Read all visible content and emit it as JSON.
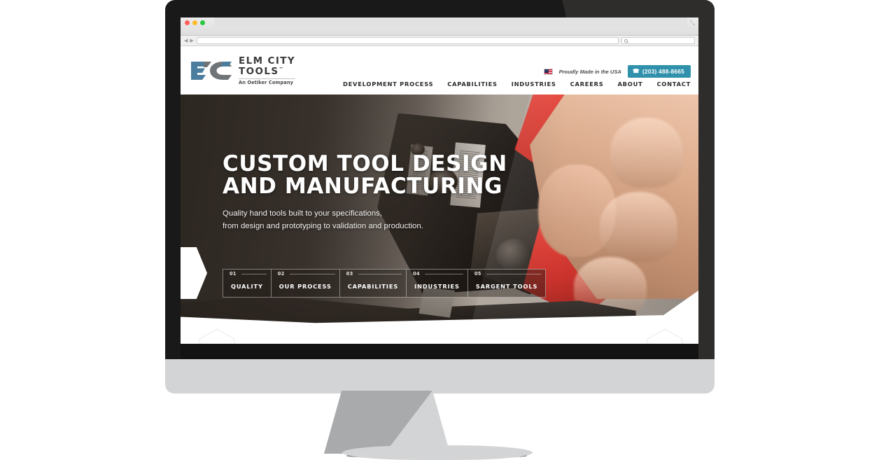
{
  "browser": {
    "traffic_lights": [
      "close",
      "minimize",
      "maximize"
    ],
    "url_value": "",
    "url_placeholder": "",
    "search_value": "",
    "search_placeholder": "",
    "back_glyph": "◀",
    "forward_glyph": "▶",
    "new_tab_glyph": "+",
    "resize_glyph": "⤡"
  },
  "site": {
    "logo": {
      "mark_alt": "EC monogram",
      "name_line1": "ELM CITY",
      "name_line2": "TOOLS",
      "trademark": "™",
      "tagline": "An Oetiker Company",
      "blue": "#4b7d9e",
      "gray": "#6f7479"
    },
    "utility": {
      "made_in_usa": "Proudly Made in the USA",
      "phone": "(203) 488-8665",
      "phone_glyph": "☎",
      "phone_button_color": "#2f91ab"
    },
    "nav": [
      {
        "label": "DEVELOPMENT PROCESS"
      },
      {
        "label": "CAPABILITIES"
      },
      {
        "label": "INDUSTRIES"
      },
      {
        "label": "CAREERS"
      },
      {
        "label": "ABOUT"
      },
      {
        "label": "CONTACT"
      }
    ],
    "hero": {
      "headline": "CUSTOM TOOL DESIGN\nAND MANUFACTURING",
      "subhead": "Quality hand tools built to your specifications,\nfrom design and prototyping to validation and production.",
      "image_alt": "Hand using red-handled crimping tool",
      "tabs": [
        {
          "num": "01",
          "label": "QUALITY"
        },
        {
          "num": "02",
          "label": "OUR PROCESS"
        },
        {
          "num": "03",
          "label": "CAPABILITIES"
        },
        {
          "num": "04",
          "label": "INDUSTRIES"
        },
        {
          "num": "05",
          "label": "SARGENT TOOLS"
        }
      ]
    }
  }
}
